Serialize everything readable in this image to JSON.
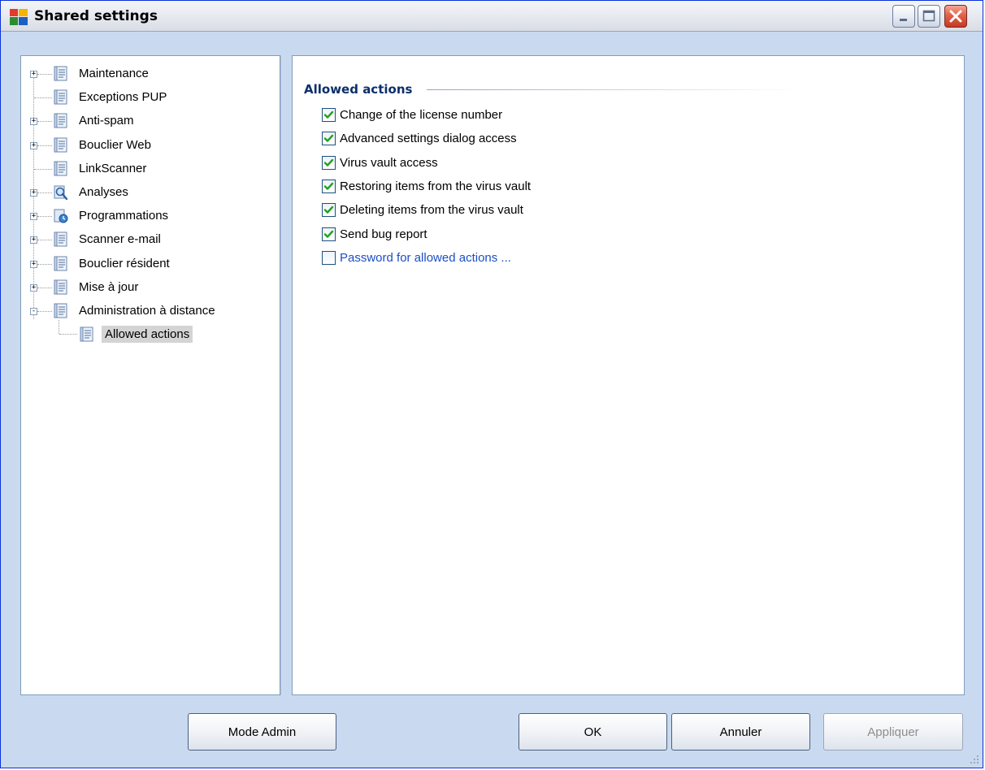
{
  "window": {
    "title": "Shared settings"
  },
  "tree": {
    "items": [
      {
        "label": "Maintenance",
        "expander": "+",
        "icon": "settings-page-icon"
      },
      {
        "label": "Exceptions PUP",
        "expander": "",
        "icon": "settings-page-icon"
      },
      {
        "label": "Anti-spam",
        "expander": "+",
        "icon": "settings-page-icon"
      },
      {
        "label": "Bouclier Web",
        "expander": "+",
        "icon": "settings-page-icon"
      },
      {
        "label": "LinkScanner",
        "expander": "",
        "icon": "settings-page-icon"
      },
      {
        "label": "Analyses",
        "expander": "+",
        "icon": "magnifier-icon"
      },
      {
        "label": "Programmations",
        "expander": "+",
        "icon": "schedule-icon"
      },
      {
        "label": "Scanner e-mail",
        "expander": "+",
        "icon": "settings-page-icon"
      },
      {
        "label": "Bouclier résident",
        "expander": "+",
        "icon": "settings-page-icon"
      },
      {
        "label": "Mise à jour",
        "expander": "+",
        "icon": "settings-page-icon"
      },
      {
        "label": "Administration à distance",
        "expander": "-",
        "icon": "settings-page-icon"
      },
      {
        "label": "Allowed actions",
        "expander": "",
        "icon": "settings-page-icon",
        "selected": true
      }
    ]
  },
  "content": {
    "section_title": "Allowed actions",
    "options": [
      {
        "label": "Change of the license number",
        "checked": true
      },
      {
        "label": "Advanced settings dialog access",
        "checked": true
      },
      {
        "label": "Virus vault access",
        "checked": true
      },
      {
        "label": "Restoring items from the virus vault",
        "checked": true
      },
      {
        "label": "Deleting items from the virus vault",
        "checked": true
      },
      {
        "label": "Send bug report",
        "checked": true
      },
      {
        "label": "Password for allowed actions ...",
        "checked": false
      }
    ]
  },
  "buttons": {
    "mode_admin": "Mode Admin",
    "ok": "OK",
    "cancel": "Annuler",
    "apply": "Appliquer",
    "apply_enabled": false
  },
  "colors": {
    "accent": "#0b2f6b",
    "link": "#1c4ec4",
    "checkmark": "#21a121",
    "background": "#c9daf0"
  }
}
